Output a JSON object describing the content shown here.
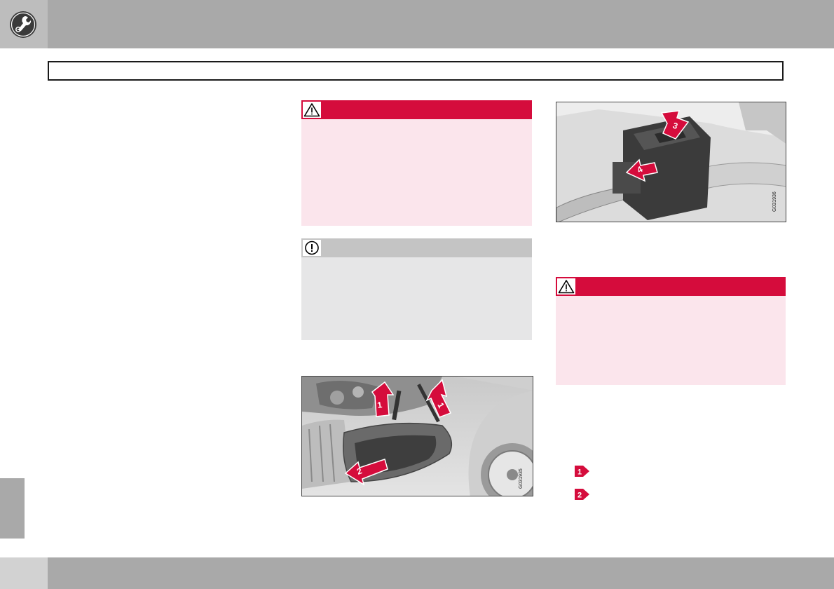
{
  "header": {
    "icon": "wrench-gear-icon",
    "title": ""
  },
  "callouts": {
    "warning1": {
      "icon": "warning-triangle-icon",
      "color": "#d50c3c",
      "body_color": "#fbe5ec"
    },
    "note1": {
      "icon": "exclamation-circle-icon",
      "color": "#c4c4c4",
      "body_color": "#e6e6e7"
    },
    "warning2": {
      "icon": "warning-triangle-icon",
      "color": "#d50c3c",
      "body_color": "#fbe5ec"
    }
  },
  "figures": {
    "headlamp": {
      "code": "G031935",
      "arrows": [
        "1",
        "2",
        "1"
      ]
    },
    "connector": {
      "code": "G031936",
      "arrows": [
        "3",
        "4"
      ]
    }
  },
  "steps": [
    {
      "number": "1",
      "icon": "step-arrow-icon"
    },
    {
      "number": "2",
      "icon": "step-arrow-icon"
    }
  ],
  "colors": {
    "header_band": "#a9a9a9",
    "accent_red": "#d50c3c"
  }
}
